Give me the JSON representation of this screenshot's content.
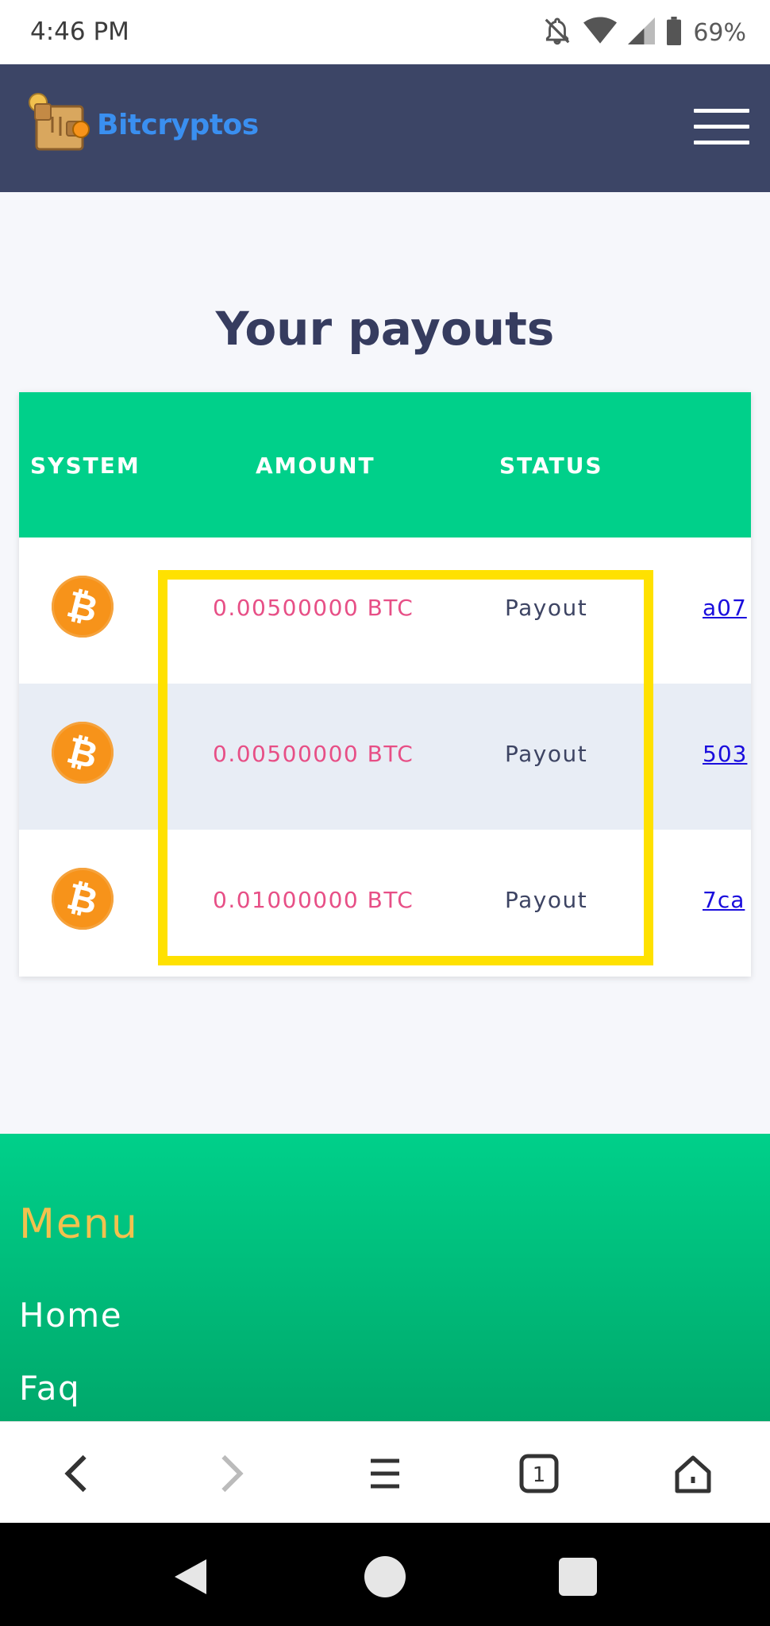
{
  "status_bar": {
    "time": "4:46 PM",
    "battery": "69%"
  },
  "header": {
    "brand": "Bitcryptos"
  },
  "main": {
    "title": "Your payouts",
    "columns": [
      "SYSTEM",
      "AMOUNT",
      "STATUS"
    ],
    "rows": [
      {
        "system": "bitcoin-icon",
        "amount": "0.00500000 BTC",
        "status": "Payout",
        "tx": "a07"
      },
      {
        "system": "bitcoin-icon",
        "amount": "0.00500000 BTC",
        "status": "Payout",
        "tx": "503"
      },
      {
        "system": "bitcoin-icon",
        "amount": "0.01000000 BTC",
        "status": "Payout",
        "tx": "7ca"
      }
    ],
    "highlight_color": "#ffe100"
  },
  "footer": {
    "heading": "Menu",
    "links": [
      "Home",
      "Faq"
    ]
  },
  "colors": {
    "header_bg": "#3c4566",
    "accent_green": "#00d08a",
    "amount_pink": "#e74f86",
    "brand_blue": "#3a8ff0",
    "menu_gold": "#f2c14e"
  }
}
